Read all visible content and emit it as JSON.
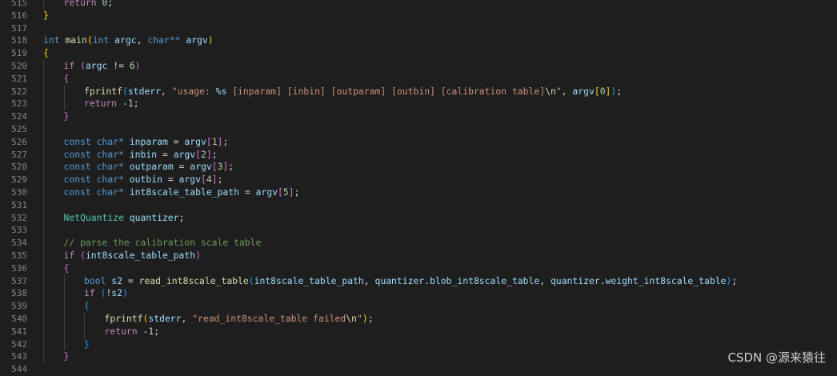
{
  "editor": {
    "lines": [
      {
        "n": "515",
        "indent": 1,
        "tokens": [
          {
            "t": "return",
            "c": "ctl"
          },
          {
            "t": " "
          },
          {
            "t": "0",
            "c": "num"
          },
          {
            "t": ";"
          }
        ]
      },
      {
        "n": "516",
        "indent": 0,
        "tokens": [
          {
            "t": "}",
            "c": "b1"
          }
        ]
      },
      {
        "n": "517",
        "indent": 0,
        "tokens": []
      },
      {
        "n": "518",
        "indent": 0,
        "tokens": [
          {
            "t": "int",
            "c": "kw"
          },
          {
            "t": " "
          },
          {
            "t": "main",
            "c": "fn"
          },
          {
            "t": "(",
            "c": "b1"
          },
          {
            "t": "int",
            "c": "kw"
          },
          {
            "t": " "
          },
          {
            "t": "argc",
            "c": "var"
          },
          {
            "t": ", "
          },
          {
            "t": "char",
            "c": "kw"
          },
          {
            "t": "** ",
            "c": "kw"
          },
          {
            "t": "argv",
            "c": "var"
          },
          {
            "t": ")",
            "c": "b1"
          }
        ]
      },
      {
        "n": "519",
        "indent": 0,
        "tokens": [
          {
            "t": "{",
            "c": "b1"
          }
        ]
      },
      {
        "n": "520",
        "indent": 1,
        "tokens": [
          {
            "t": "if",
            "c": "ctl"
          },
          {
            "t": " "
          },
          {
            "t": "(",
            "c": "b2"
          },
          {
            "t": "argc",
            "c": "var"
          },
          {
            "t": " != "
          },
          {
            "t": "6",
            "c": "num"
          },
          {
            "t": ")",
            "c": "b2"
          }
        ]
      },
      {
        "n": "521",
        "indent": 1,
        "tokens": [
          {
            "t": "{",
            "c": "b2"
          }
        ]
      },
      {
        "n": "522",
        "indent": 2,
        "tokens": [
          {
            "t": "fprintf",
            "c": "fn"
          },
          {
            "t": "(",
            "c": "b3"
          },
          {
            "t": "stderr",
            "c": "var"
          },
          {
            "t": ", "
          },
          {
            "t": "\"usage: ",
            "c": "str"
          },
          {
            "t": "%s",
            "c": "var"
          },
          {
            "t": " [inparam] [inbin] [outparam] [outbin] [calibration table]",
            "c": "str"
          },
          {
            "t": "\\n",
            "c": "fn"
          },
          {
            "t": "\"",
            "c": "str"
          },
          {
            "t": ", "
          },
          {
            "t": "argv",
            "c": "var"
          },
          {
            "t": "[",
            "c": "b1"
          },
          {
            "t": "0",
            "c": "num"
          },
          {
            "t": "]",
            "c": "b1"
          },
          {
            "t": ")",
            "c": "b3"
          },
          {
            "t": ";"
          }
        ]
      },
      {
        "n": "523",
        "indent": 2,
        "tokens": [
          {
            "t": "return",
            "c": "ctl"
          },
          {
            "t": " -"
          },
          {
            "t": "1",
            "c": "num"
          },
          {
            "t": ";"
          }
        ]
      },
      {
        "n": "524",
        "indent": 1,
        "tokens": [
          {
            "t": "}",
            "c": "b2"
          }
        ]
      },
      {
        "n": "525",
        "indent": 0,
        "tokens": []
      },
      {
        "n": "526",
        "indent": 1,
        "tokens": [
          {
            "t": "const",
            "c": "kw"
          },
          {
            "t": " "
          },
          {
            "t": "char",
            "c": "kw"
          },
          {
            "t": "* ",
            "c": "kw"
          },
          {
            "t": "inparam",
            "c": "var"
          },
          {
            "t": " = "
          },
          {
            "t": "argv",
            "c": "var"
          },
          {
            "t": "[",
            "c": "b2"
          },
          {
            "t": "1",
            "c": "num"
          },
          {
            "t": "]",
            "c": "b2"
          },
          {
            "t": ";"
          }
        ]
      },
      {
        "n": "527",
        "indent": 1,
        "tokens": [
          {
            "t": "const",
            "c": "kw"
          },
          {
            "t": " "
          },
          {
            "t": "char",
            "c": "kw"
          },
          {
            "t": "* ",
            "c": "kw"
          },
          {
            "t": "inbin",
            "c": "var"
          },
          {
            "t": " = "
          },
          {
            "t": "argv",
            "c": "var"
          },
          {
            "t": "[",
            "c": "b2"
          },
          {
            "t": "2",
            "c": "num"
          },
          {
            "t": "]",
            "c": "b2"
          },
          {
            "t": ";"
          }
        ]
      },
      {
        "n": "528",
        "indent": 1,
        "tokens": [
          {
            "t": "const",
            "c": "kw"
          },
          {
            "t": " "
          },
          {
            "t": "char",
            "c": "kw"
          },
          {
            "t": "* ",
            "c": "kw"
          },
          {
            "t": "outparam",
            "c": "var"
          },
          {
            "t": " = "
          },
          {
            "t": "argv",
            "c": "var"
          },
          {
            "t": "[",
            "c": "b2"
          },
          {
            "t": "3",
            "c": "num"
          },
          {
            "t": "]",
            "c": "b2"
          },
          {
            "t": ";"
          }
        ]
      },
      {
        "n": "529",
        "indent": 1,
        "tokens": [
          {
            "t": "const",
            "c": "kw"
          },
          {
            "t": " "
          },
          {
            "t": "char",
            "c": "kw"
          },
          {
            "t": "* ",
            "c": "kw"
          },
          {
            "t": "outbin",
            "c": "var"
          },
          {
            "t": " = "
          },
          {
            "t": "argv",
            "c": "var"
          },
          {
            "t": "[",
            "c": "b2"
          },
          {
            "t": "4",
            "c": "num"
          },
          {
            "t": "]",
            "c": "b2"
          },
          {
            "t": ";"
          }
        ]
      },
      {
        "n": "530",
        "indent": 1,
        "tokens": [
          {
            "t": "const",
            "c": "kw"
          },
          {
            "t": " "
          },
          {
            "t": "char",
            "c": "kw"
          },
          {
            "t": "* ",
            "c": "kw"
          },
          {
            "t": "int8scale_table_path",
            "c": "var"
          },
          {
            "t": " = "
          },
          {
            "t": "argv",
            "c": "var"
          },
          {
            "t": "[",
            "c": "b2"
          },
          {
            "t": "5",
            "c": "num"
          },
          {
            "t": "]",
            "c": "b2"
          },
          {
            "t": ";"
          }
        ]
      },
      {
        "n": "531",
        "indent": 0,
        "tokens": []
      },
      {
        "n": "532",
        "indent": 1,
        "tokens": [
          {
            "t": "NetQuantize",
            "c": "typ"
          },
          {
            "t": " "
          },
          {
            "t": "quantizer",
            "c": "var"
          },
          {
            "t": ";"
          }
        ]
      },
      {
        "n": "533",
        "indent": 0,
        "tokens": []
      },
      {
        "n": "534",
        "indent": 1,
        "tokens": [
          {
            "t": "// parse the calibration scale table",
            "c": "cmt"
          }
        ]
      },
      {
        "n": "535",
        "indent": 1,
        "tokens": [
          {
            "t": "if",
            "c": "ctl"
          },
          {
            "t": " "
          },
          {
            "t": "(",
            "c": "b2"
          },
          {
            "t": "int8scale_table_path",
            "c": "var"
          },
          {
            "t": ")",
            "c": "b2"
          }
        ]
      },
      {
        "n": "536",
        "indent": 1,
        "tokens": [
          {
            "t": "{",
            "c": "b2"
          }
        ]
      },
      {
        "n": "537",
        "indent": 2,
        "tokens": [
          {
            "t": "bool",
            "c": "kw"
          },
          {
            "t": " "
          },
          {
            "t": "s2",
            "c": "var"
          },
          {
            "t": " = "
          },
          {
            "t": "read_int8scale_table",
            "c": "fn"
          },
          {
            "t": "(",
            "c": "b3"
          },
          {
            "t": "int8scale_table_path",
            "c": "var"
          },
          {
            "t": ", "
          },
          {
            "t": "quantizer",
            "c": "var"
          },
          {
            "t": "."
          },
          {
            "t": "blob_int8scale_table",
            "c": "var"
          },
          {
            "t": ", "
          },
          {
            "t": "quantizer",
            "c": "var"
          },
          {
            "t": "."
          },
          {
            "t": "weight_int8scale_table",
            "c": "var"
          },
          {
            "t": ")",
            "c": "b3"
          },
          {
            "t": ";"
          }
        ]
      },
      {
        "n": "538",
        "indent": 2,
        "tokens": [
          {
            "t": "if",
            "c": "ctl"
          },
          {
            "t": " "
          },
          {
            "t": "(",
            "c": "b3"
          },
          {
            "t": "!"
          },
          {
            "t": "s2",
            "c": "var"
          },
          {
            "t": ")",
            "c": "b3"
          }
        ]
      },
      {
        "n": "539",
        "indent": 2,
        "tokens": [
          {
            "t": "{",
            "c": "b3"
          }
        ]
      },
      {
        "n": "540",
        "indent": 3,
        "tokens": [
          {
            "t": "fprintf",
            "c": "fn"
          },
          {
            "t": "(",
            "c": "b1"
          },
          {
            "t": "stderr",
            "c": "var"
          },
          {
            "t": ", "
          },
          {
            "t": "\"read_int8scale_table failed",
            "c": "str"
          },
          {
            "t": "\\n",
            "c": "fn"
          },
          {
            "t": "\"",
            "c": "str"
          },
          {
            "t": ")",
            "c": "b1"
          },
          {
            "t": ";"
          }
        ]
      },
      {
        "n": "541",
        "indent": 3,
        "tokens": [
          {
            "t": "return",
            "c": "ctl"
          },
          {
            "t": " -"
          },
          {
            "t": "1",
            "c": "num"
          },
          {
            "t": ";"
          }
        ]
      },
      {
        "n": "542",
        "indent": 2,
        "tokens": [
          {
            "t": "}",
            "c": "b3"
          }
        ]
      },
      {
        "n": "543",
        "indent": 1,
        "tokens": [
          {
            "t": "}",
            "c": "b2"
          }
        ]
      },
      {
        "n": "544",
        "indent": 0,
        "tokens": []
      }
    ]
  },
  "watermark": "CSDN @源来猿往"
}
